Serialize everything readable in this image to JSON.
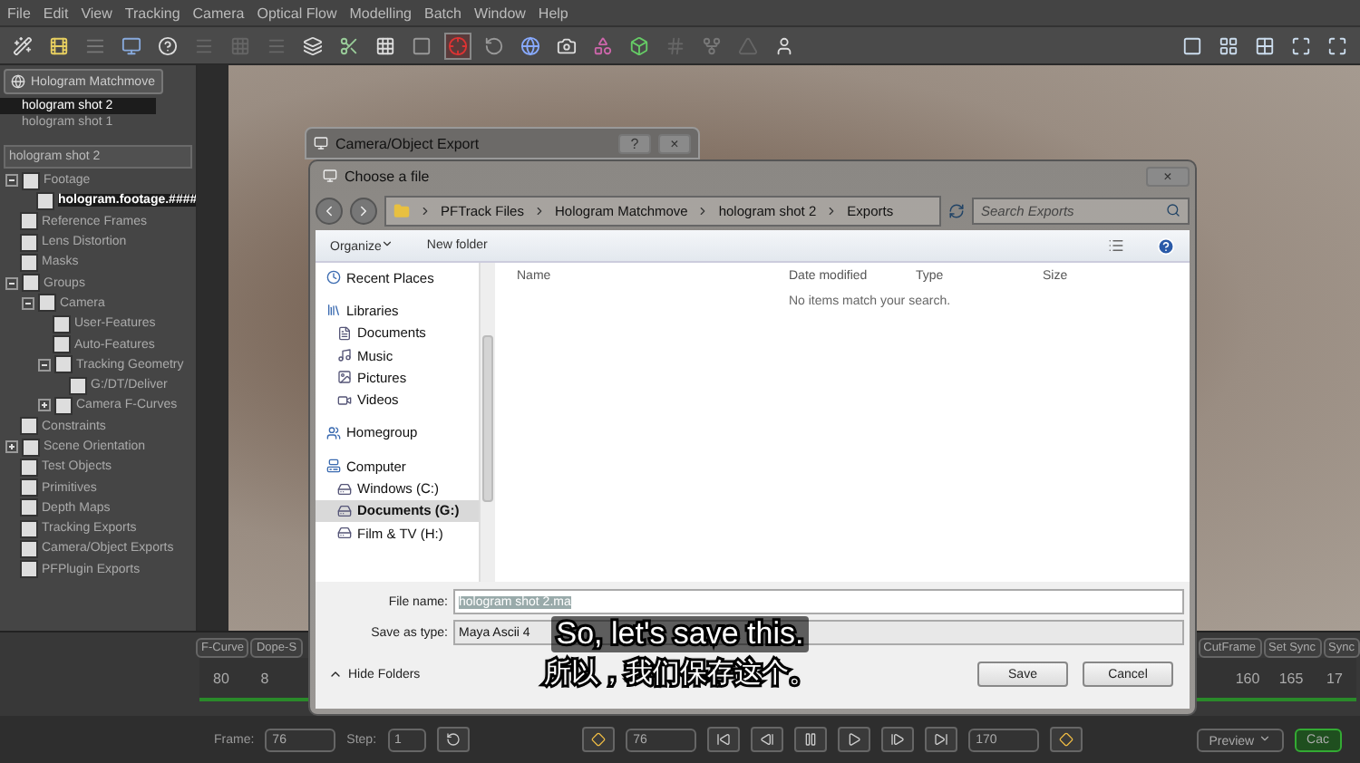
{
  "menu": [
    "File",
    "Edit",
    "View",
    "Tracking",
    "Camera",
    "Optical Flow",
    "Modelling",
    "Batch",
    "Window",
    "Help"
  ],
  "project": {
    "title": "Hologram Matchmove",
    "shots": [
      {
        "label": "hologram shot 2",
        "selected": true
      },
      {
        "label": "hologram shot 1",
        "selected": false
      }
    ]
  },
  "tree": {
    "title": "hologram shot 2",
    "items": [
      {
        "label": "Footage",
        "expanded": true,
        "children": [
          {
            "label": "hologram.footage.####",
            "selected": true
          }
        ]
      },
      {
        "label": "Reference Frames"
      },
      {
        "label": "Lens Distortion"
      },
      {
        "label": "Masks"
      },
      {
        "label": "Groups",
        "expanded": true,
        "children": [
          {
            "label": "Camera",
            "expanded": true,
            "children": [
              {
                "label": "User-Features"
              },
              {
                "label": "Auto-Features"
              },
              {
                "label": "Tracking Geometry",
                "expanded": true,
                "children": [
                  {
                    "label": "G:/DT/Deliver"
                  }
                ]
              },
              {
                "label": "Camera F-Curves",
                "expanded": false
              }
            ]
          }
        ]
      },
      {
        "label": "Constraints"
      },
      {
        "label": "Scene Orientation",
        "expanded": false
      },
      {
        "label": "Test Objects"
      },
      {
        "label": "Primitives"
      },
      {
        "label": "Depth Maps"
      },
      {
        "label": "Tracking Exports"
      },
      {
        "label": "Camera/Object Exports"
      },
      {
        "label": "PFPlugin Exports"
      }
    ]
  },
  "export_dialog": {
    "title": "Camera/Object Export",
    "help": "?",
    "close": "×"
  },
  "file_dialog": {
    "title": "Choose a file",
    "close": "×",
    "breadcrumb": [
      "PFTrack Files",
      "Hologram Matchmove",
      "hologram shot 2",
      "Exports"
    ],
    "search": {
      "placeholder": "Search Exports"
    },
    "toolbar": [
      "Organize",
      "New folder"
    ],
    "nav": [
      {
        "label": "Recent Places",
        "selected": false
      },
      {
        "label": "Libraries",
        "selected": false,
        "children": [
          {
            "label": "Documents",
            "selected": false
          },
          {
            "label": "Music",
            "selected": false
          },
          {
            "label": "Pictures",
            "selected": false
          },
          {
            "label": "Videos",
            "selected": false
          }
        ]
      },
      {
        "label": "Homegroup",
        "selected": false
      },
      {
        "label": "Computer",
        "selected": false,
        "children": [
          {
            "label": "Windows (C:)",
            "selected": false
          },
          {
            "label": "Documents (G:)",
            "selected": true
          },
          {
            "label": "Film & TV (H:)",
            "selected": false
          }
        ]
      }
    ],
    "columns": [
      "Name",
      "Date modified",
      "Type",
      "Size"
    ],
    "empty_message": "No items match your search.",
    "file_name": {
      "label": "File name:",
      "value": "hologram shot 2.ma"
    },
    "save_type": {
      "label": "Save as type:",
      "value": "Maya Ascii 4"
    },
    "hide_folders": "Hide Folders",
    "buttons": [
      "Save",
      "Cancel"
    ]
  },
  "subtitles": [
    "So, let's save this.",
    "所以，我们保存这个。"
  ],
  "timeline": {
    "left_buttons": [
      "F-Curve",
      "Dope-S"
    ],
    "left_ticks": [
      "80",
      "8"
    ],
    "right_buttons": [
      "CutFrame",
      "Set Sync",
      "Sync"
    ],
    "right_ticks": [
      "160",
      "165",
      "17"
    ]
  },
  "playback": {
    "frame_label": "Frame:",
    "frame": "76",
    "step_label": "Step:",
    "step": "1",
    "current": "76",
    "end": "170",
    "preview": "Preview",
    "cache": "Cac"
  }
}
